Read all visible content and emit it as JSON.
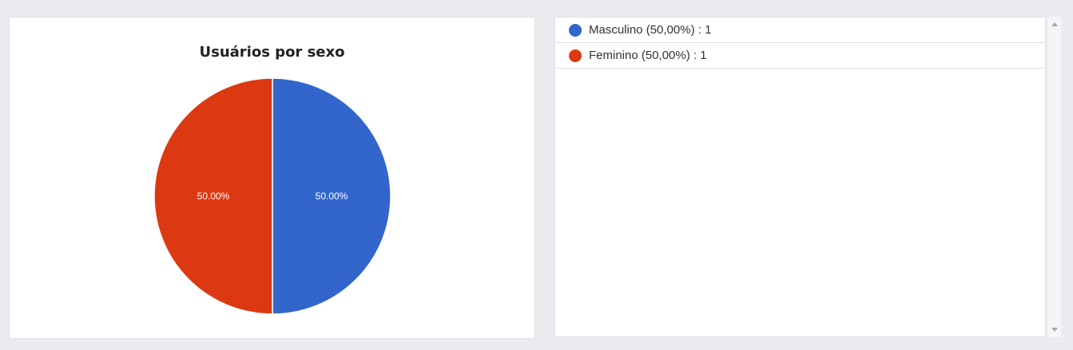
{
  "chart_data": {
    "type": "pie",
    "title": "Usuários por sexo",
    "categories": [
      "Masculino",
      "Feminino"
    ],
    "values": [
      1,
      1
    ],
    "data_labels": [
      "50.00%",
      "50.00%"
    ],
    "colors": [
      "#3366cc",
      "#dc3912"
    ]
  },
  "legend": {
    "items": [
      {
        "label": "Masculino (50,00%) : 1",
        "color": "#3366cc"
      },
      {
        "label": "Feminino (50,00%) : 1",
        "color": "#dc3912"
      }
    ]
  }
}
